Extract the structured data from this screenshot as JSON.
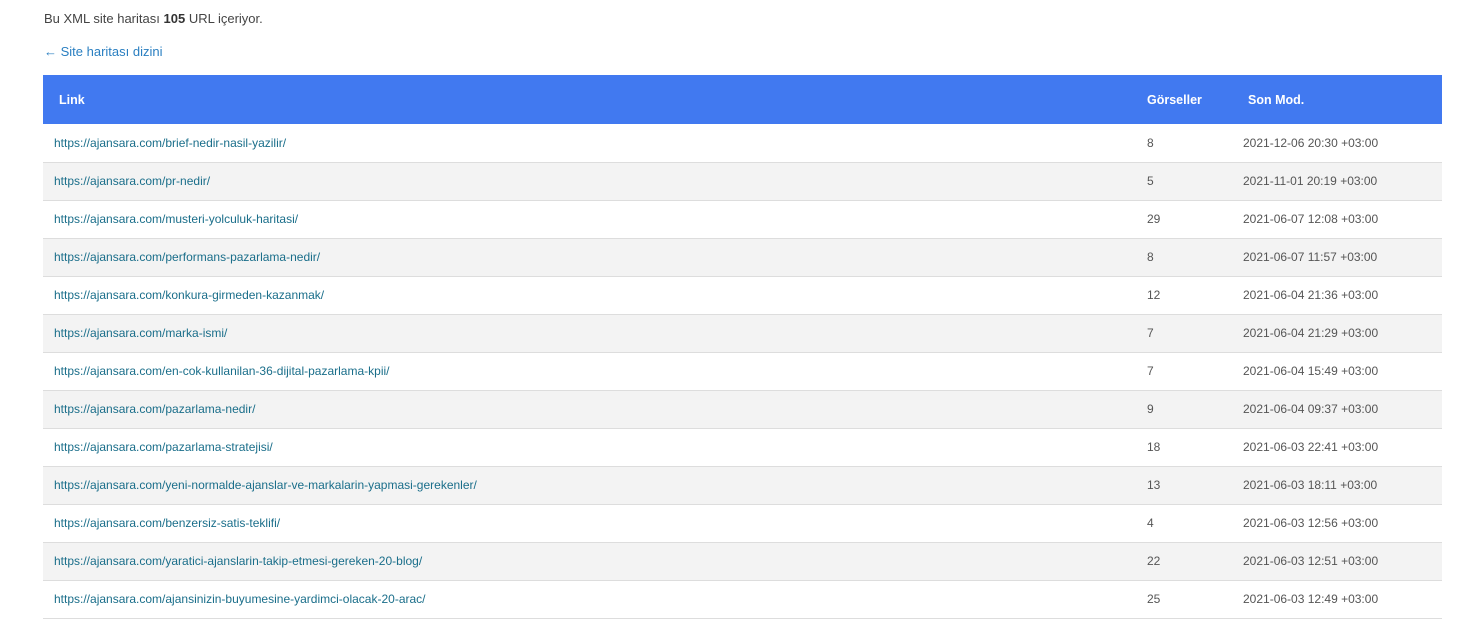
{
  "summary": {
    "prefix": "Bu XML site haritası",
    "count": "105",
    "suffix": "URL içeriyor."
  },
  "back_link": "← Site haritası dizini",
  "table": {
    "headers": {
      "link": "Link",
      "images": "Görseller",
      "modified": "Son Mod."
    },
    "rows": [
      {
        "url": "https://ajansara.com/brief-nedir-nasil-yazilir/",
        "images": "8",
        "modified": "2021-12-06 20:30 +03:00"
      },
      {
        "url": "https://ajansara.com/pr-nedir/",
        "images": "5",
        "modified": "2021-11-01 20:19 +03:00"
      },
      {
        "url": "https://ajansara.com/musteri-yolculuk-haritasi/",
        "images": "29",
        "modified": "2021-06-07 12:08 +03:00"
      },
      {
        "url": "https://ajansara.com/performans-pazarlama-nedir/",
        "images": "8",
        "modified": "2021-06-07 11:57 +03:00"
      },
      {
        "url": "https://ajansara.com/konkura-girmeden-kazanmak/",
        "images": "12",
        "modified": "2021-06-04 21:36 +03:00"
      },
      {
        "url": "https://ajansara.com/marka-ismi/",
        "images": "7",
        "modified": "2021-06-04 21:29 +03:00"
      },
      {
        "url": "https://ajansara.com/en-cok-kullanilan-36-dijital-pazarlama-kpii/",
        "images": "7",
        "modified": "2021-06-04 15:49 +03:00"
      },
      {
        "url": "https://ajansara.com/pazarlama-nedir/",
        "images": "9",
        "modified": "2021-06-04 09:37 +03:00"
      },
      {
        "url": "https://ajansara.com/pazarlama-stratejisi/",
        "images": "18",
        "modified": "2021-06-03 22:41 +03:00"
      },
      {
        "url": "https://ajansara.com/yeni-normalde-ajanslar-ve-markalarin-yapmasi-gerekenler/",
        "images": "13",
        "modified": "2021-06-03 18:11 +03:00"
      },
      {
        "url": "https://ajansara.com/benzersiz-satis-teklifi/",
        "images": "4",
        "modified": "2021-06-03 12:56 +03:00"
      },
      {
        "url": "https://ajansara.com/yaratici-ajanslarin-takip-etmesi-gereken-20-blog/",
        "images": "22",
        "modified": "2021-06-03 12:51 +03:00"
      },
      {
        "url": "https://ajansara.com/ajansinizin-buyumesine-yardimci-olacak-20-arac/",
        "images": "25",
        "modified": "2021-06-03 12:49 +03:00"
      }
    ]
  }
}
